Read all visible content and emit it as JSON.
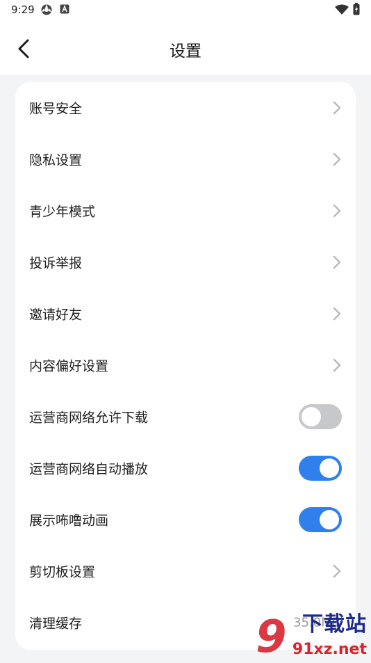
{
  "status_bar": {
    "time": "9:29"
  },
  "header": {
    "title": "设置"
  },
  "settings": {
    "items": [
      {
        "label": "账号安全",
        "control": "chevron"
      },
      {
        "label": "隐私设置",
        "control": "chevron"
      },
      {
        "label": "青少年模式",
        "control": "chevron"
      },
      {
        "label": "投诉举报",
        "control": "chevron"
      },
      {
        "label": "邀请好友",
        "control": "chevron"
      },
      {
        "label": "内容偏好设置",
        "control": "chevron"
      },
      {
        "label": "运营商网络允许下载",
        "control": "toggle",
        "enabled": false
      },
      {
        "label": "运营商网络自动播放",
        "control": "toggle",
        "enabled": true
      },
      {
        "label": "展示咘噜动画",
        "control": "toggle",
        "enabled": true
      },
      {
        "label": "剪切板设置",
        "control": "chevron"
      },
      {
        "label": "清理缓存",
        "control": "value",
        "value": "35.0MB"
      }
    ]
  },
  "watermark": {
    "logo": "9",
    "brand": "下载站",
    "site": "91xz.net"
  },
  "colors": {
    "toggle_on": "#2f80ec",
    "toggle_off": "#c7c8cc",
    "background": "#f3f4f6",
    "card": "#ffffff"
  }
}
